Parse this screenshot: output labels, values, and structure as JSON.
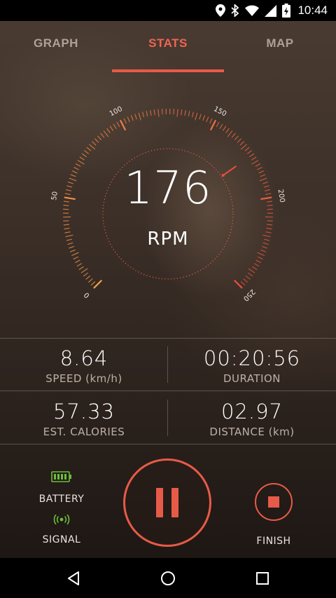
{
  "status_bar": {
    "time": "10:44",
    "icons": [
      "location-icon",
      "bluetooth-icon",
      "wifi-icon",
      "signal-icon",
      "battery-charging-icon"
    ]
  },
  "tabs": [
    {
      "label": "GRAPH",
      "active": false
    },
    {
      "label": "STATS",
      "active": true
    },
    {
      "label": "MAP",
      "active": false
    }
  ],
  "gauge": {
    "value": "176",
    "unit": "RPM",
    "min": 0,
    "max": 250,
    "current": 176,
    "tick_labels": [
      "0",
      "50",
      "100",
      "150",
      "200",
      "250"
    ],
    "colors": {
      "low": "#f2a04a",
      "high": "#e8503e",
      "inner_ring": "#e85a48"
    }
  },
  "stats": {
    "speed": {
      "value": "8.64",
      "label": "SPEED (km/h)"
    },
    "duration": {
      "value": "00:20:56",
      "label": "DURATION"
    },
    "calories": {
      "value": "57.33",
      "label": "EST. CALORIES"
    },
    "distance": {
      "value": "02.97",
      "label": "DISTANCE (km)"
    }
  },
  "controls": {
    "battery_label": "BATTERY",
    "signal_label": "SIGNAL",
    "finish_label": "FINISH",
    "battery_color": "#6bbf3a",
    "signal_color": "#6bbf3a",
    "accent": "#e85a48"
  },
  "nav": {
    "icons": [
      "back-icon",
      "home-icon",
      "recents-icon"
    ]
  }
}
